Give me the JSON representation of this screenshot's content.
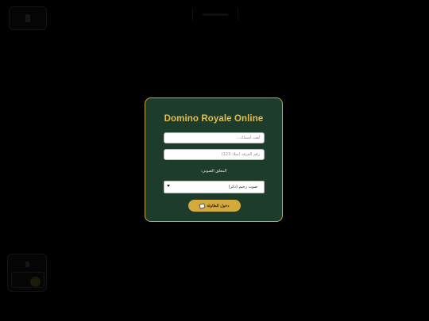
{
  "modal": {
    "title": "Domino Royale Online",
    "name_placeholder": "لقب أسماك...",
    "room_placeholder": "رقم الغرفة (مثلا: 123)",
    "voice_label": "المعلق الصوتي:",
    "voice_selected": "صوت رخيم (ذكر)",
    "enter_button": "دخول الطاولة"
  },
  "colors": {
    "background": "#000000",
    "modal_bg": "#1d3c2c",
    "accent_gold": "#d4aa3c"
  }
}
